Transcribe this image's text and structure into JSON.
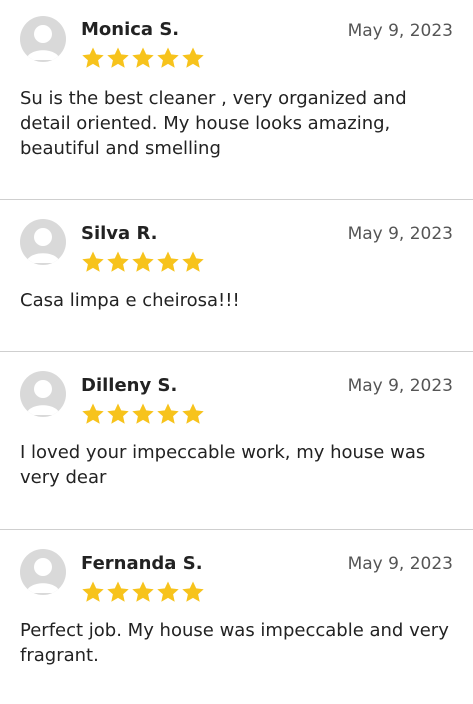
{
  "theme": {
    "star_color": "#f7c31c",
    "avatar_bg": "#d9d9d9",
    "divider": "#cfcfcf"
  },
  "reviews": [
    {
      "name": "Monica S.",
      "date": "May 9, 2023",
      "rating": 5,
      "text": "Su is the best cleaner , very organized and detail oriented. My house looks amazing, beautiful and smelling"
    },
    {
      "name": "Silva R.",
      "date": "May 9, 2023",
      "rating": 5,
      "text": "Casa limpa e cheirosa!!!"
    },
    {
      "name": "Dilleny S.",
      "date": "May 9, 2023",
      "rating": 5,
      "text": "I loved your impeccable work, my house was very dear"
    },
    {
      "name": "Fernanda S.",
      "date": "May 9, 2023",
      "rating": 5,
      "text": "Perfect job. My house was impeccable and very fragrant."
    }
  ]
}
